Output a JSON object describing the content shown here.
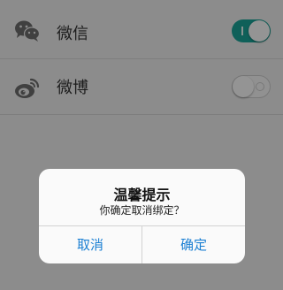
{
  "settings": {
    "items": [
      {
        "label": "微信",
        "icon": "wechat-icon",
        "enabled": true
      },
      {
        "label": "微博",
        "icon": "weibo-icon",
        "enabled": false
      }
    ]
  },
  "dialog": {
    "title": "温馨提示",
    "message": "你确定取消绑定？",
    "cancel_label": "取消",
    "confirm_label": "确定"
  },
  "colors": {
    "accent": "#1aa59a",
    "button_text": "#1a7fd3"
  }
}
